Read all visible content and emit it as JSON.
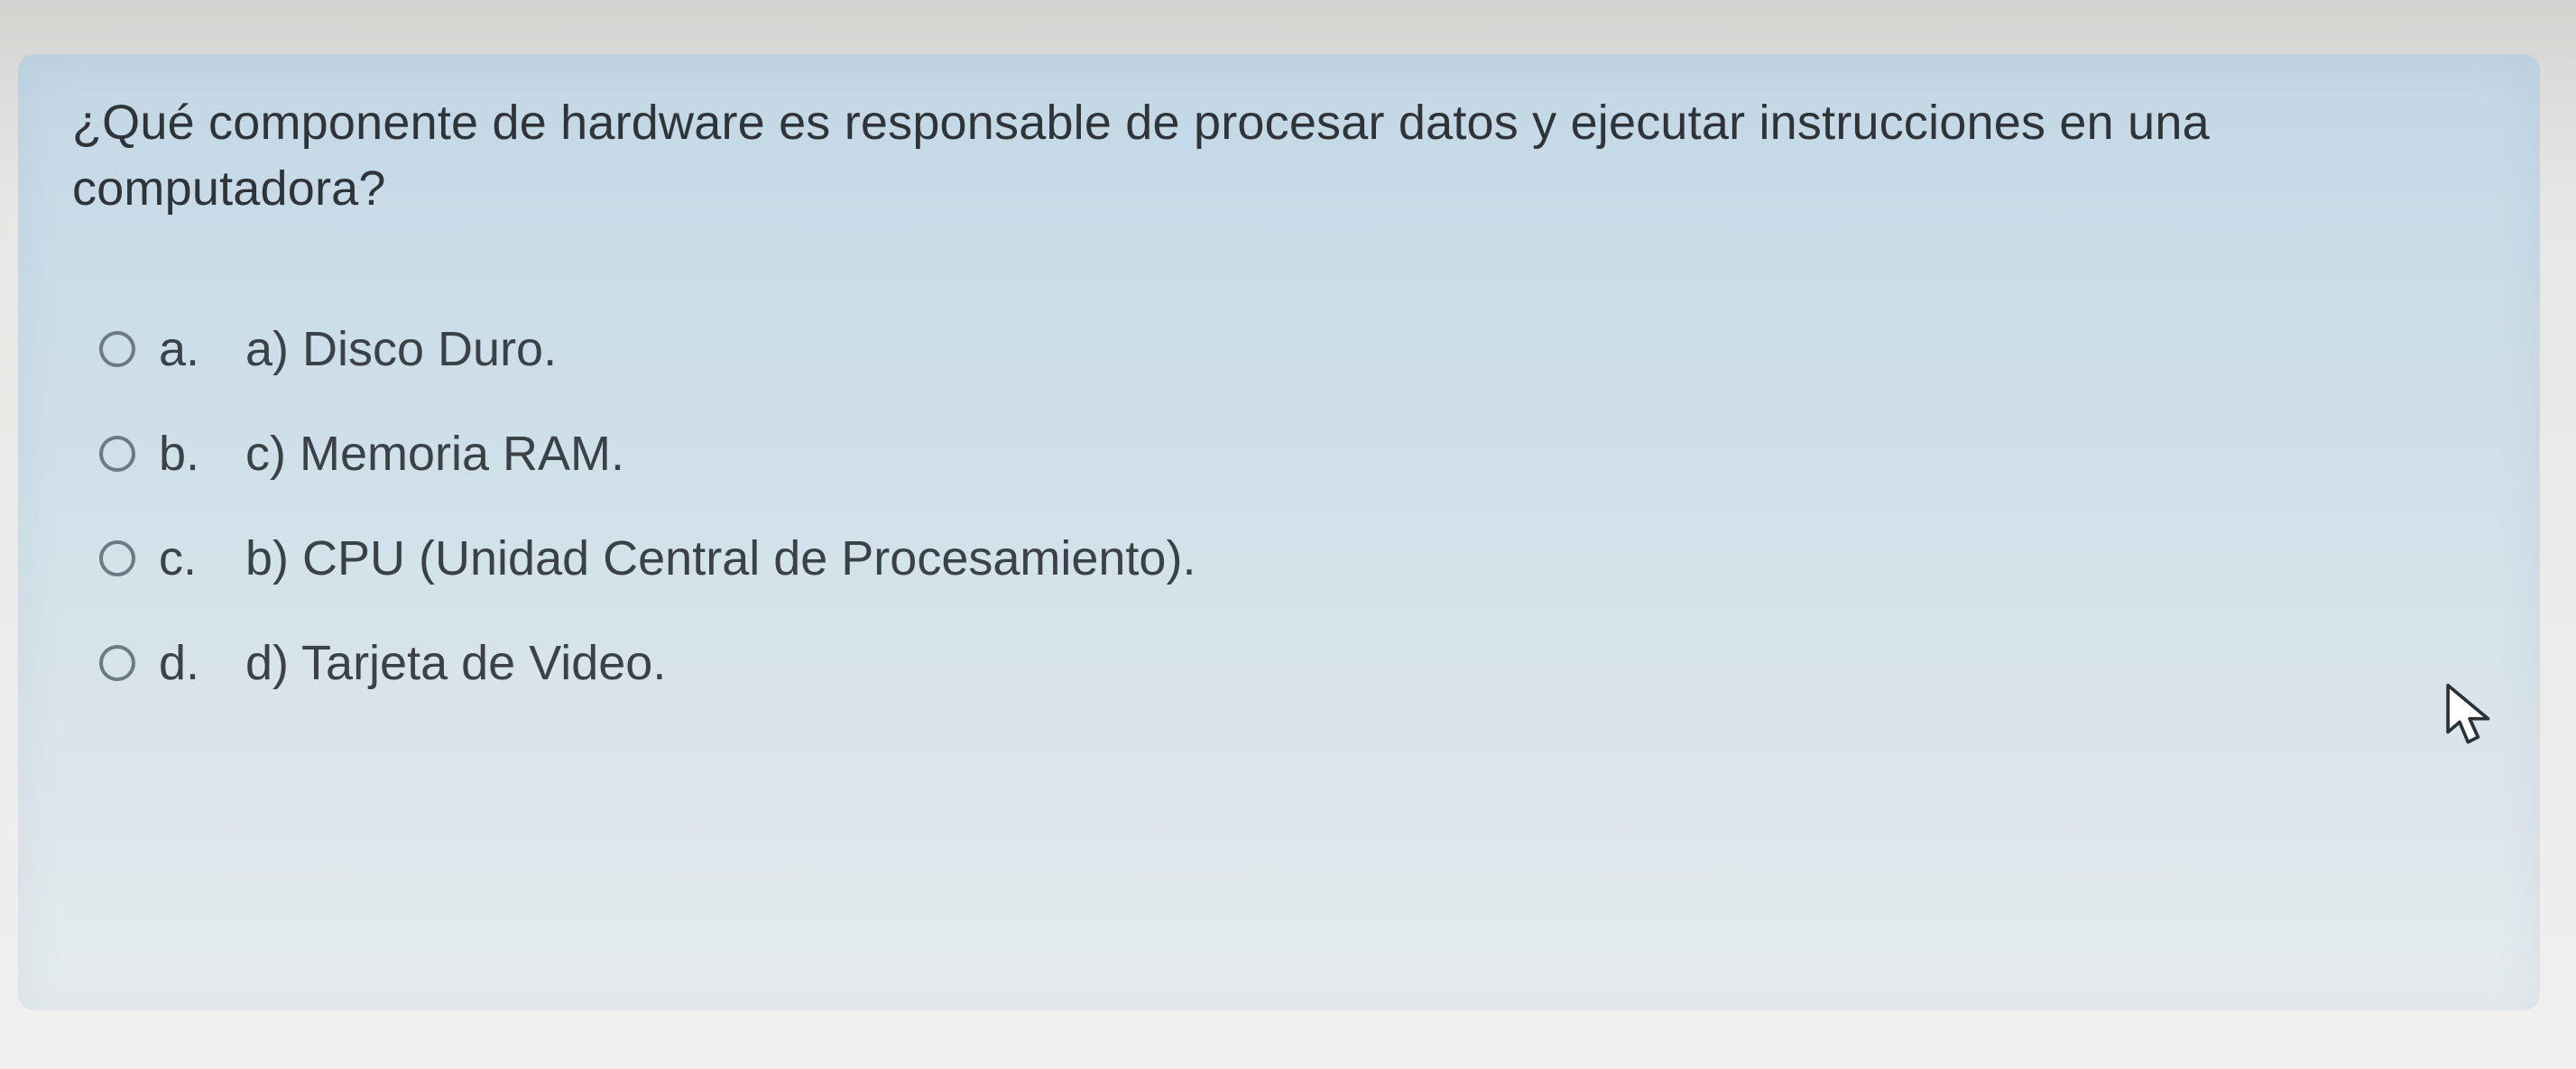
{
  "question": {
    "text": "¿Qué componente de hardware es responsable de procesar datos y ejecutar instrucciones en una computadora?"
  },
  "options": [
    {
      "letter": "a.",
      "label": "a) Disco Duro."
    },
    {
      "letter": "b.",
      "label": "c) Memoria RAM."
    },
    {
      "letter": "c.",
      "label": "b) CPU (Unidad Central de Procesamiento)."
    },
    {
      "letter": "d.",
      "label": "d) Tarjeta de Video."
    }
  ]
}
